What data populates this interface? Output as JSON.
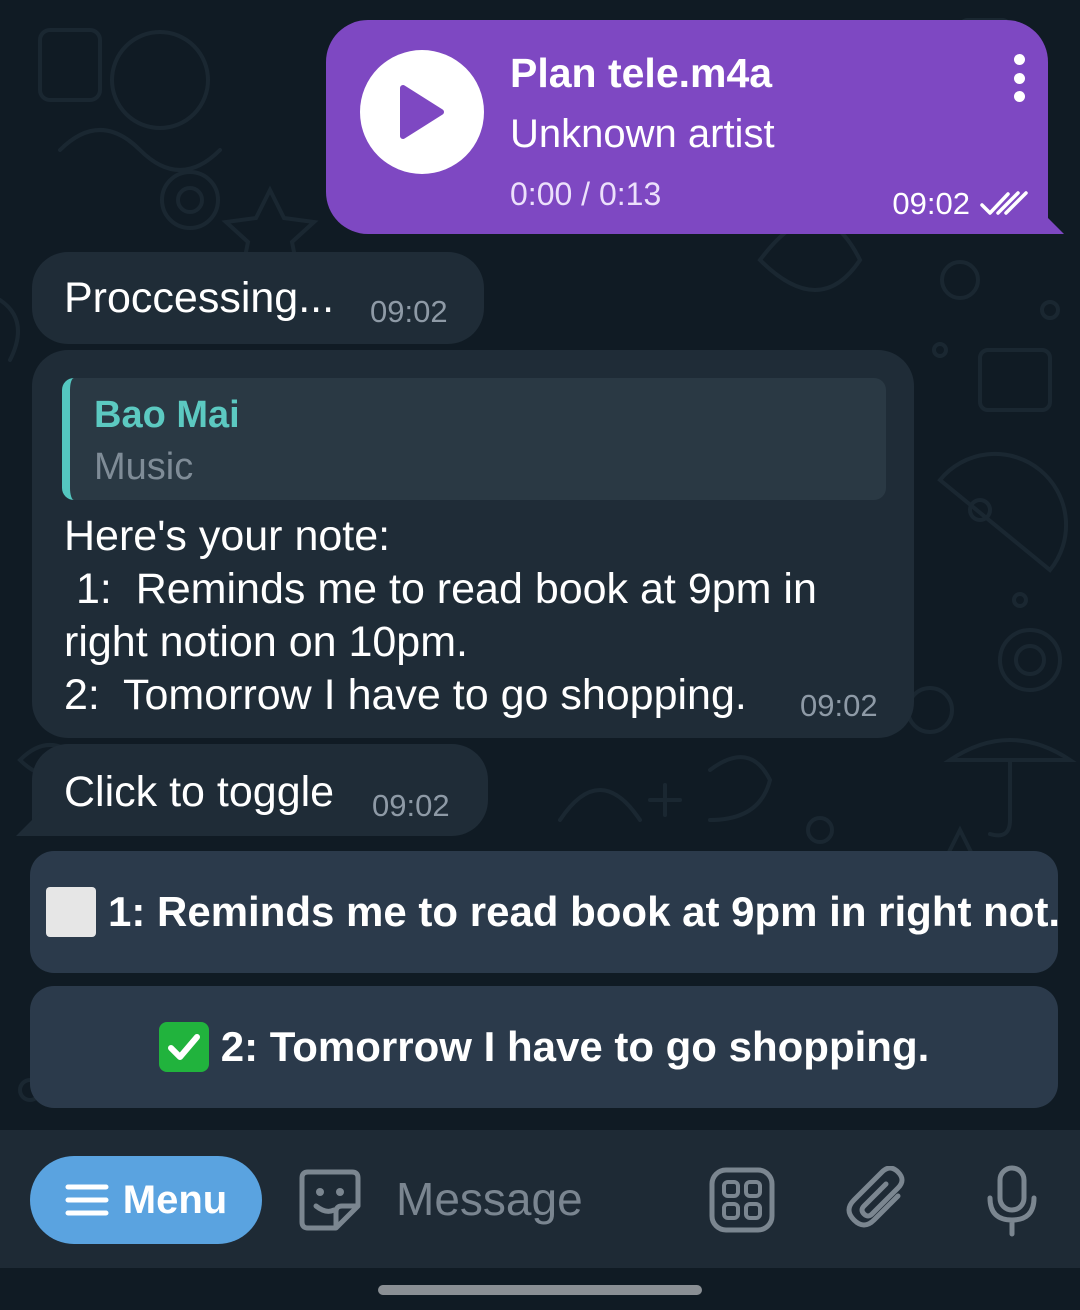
{
  "audio_message": {
    "title": "Plan tele.m4a",
    "artist": "Unknown artist",
    "progress": "0:00 / 0:13",
    "time": "09:02",
    "status": "read"
  },
  "messages": [
    {
      "text": "Proccessing...",
      "time": "09:02"
    },
    {
      "reply": {
        "name": "Bao Mai",
        "subtitle": "Music"
      },
      "body": "Here's your note:\n 1:  Reminds me to read book at 9pm in\nright notion on 10pm.\n2:  Tomorrow I have to go shopping.",
      "time": "09:02"
    },
    {
      "text": "Click to toggle",
      "time": "09:02"
    }
  ],
  "keyboard": [
    {
      "label": "1:  Reminds me to read book at 9pm in right not...",
      "checked": false
    },
    {
      "label": "2:  Tomorrow I have to go shopping.",
      "checked": true
    }
  ],
  "input_bar": {
    "menu_label": "Menu",
    "placeholder": "Message"
  },
  "colors": {
    "outgoing_bubble": "#7e48c2",
    "incoming_bubble": "#1f2c37",
    "menu_button": "#5aa3e0",
    "reply_accent": "#54c7c0"
  },
  "icons": [
    "play-icon",
    "more-vert-icon",
    "double-check-icon",
    "sticker-icon",
    "bot-commands-icon",
    "attach-icon",
    "mic-icon",
    "menu-lines-icon"
  ]
}
